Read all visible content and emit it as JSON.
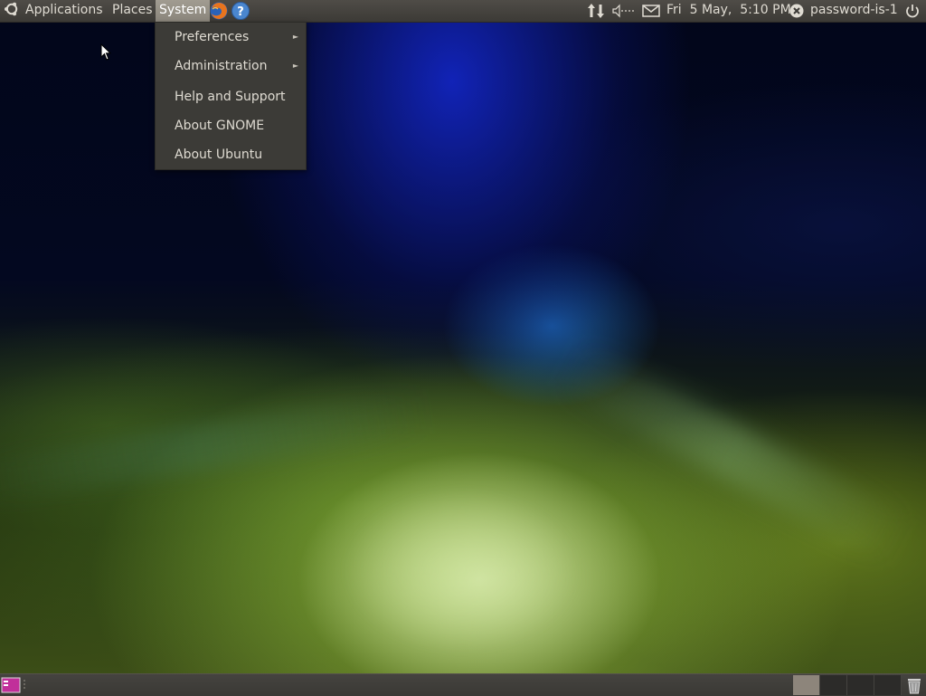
{
  "top_panel": {
    "menus": {
      "applications": "Applications",
      "places": "Places",
      "system": "System"
    },
    "launchers": [
      "firefox-icon",
      "help-icon"
    ],
    "clock": "Fri  5 May,  5:10 PM",
    "user": "password-is-1",
    "tray_icons": [
      "network-icon",
      "volume-icon",
      "mail-icon",
      "user-status-icon",
      "power-icon"
    ]
  },
  "system_menu": {
    "items": [
      {
        "label": "Preferences",
        "submenu": true
      },
      {
        "label": "Administration",
        "submenu": true
      },
      {
        "label": "Help and Support",
        "submenu": false
      },
      {
        "label": "About GNOME",
        "submenu": false
      },
      {
        "label": "About Ubuntu",
        "submenu": false
      }
    ],
    "submenu_arrow": "►"
  },
  "bottom_panel": {
    "workspaces": 4,
    "active_workspace": 1,
    "icons": [
      "show-desktop-icon",
      "trash-icon"
    ]
  },
  "colors": {
    "panel": "#3c3a36",
    "panel_text": "#dfdbd2",
    "active_menu": "#8a857b",
    "menu_bg": "#3c3b37"
  }
}
